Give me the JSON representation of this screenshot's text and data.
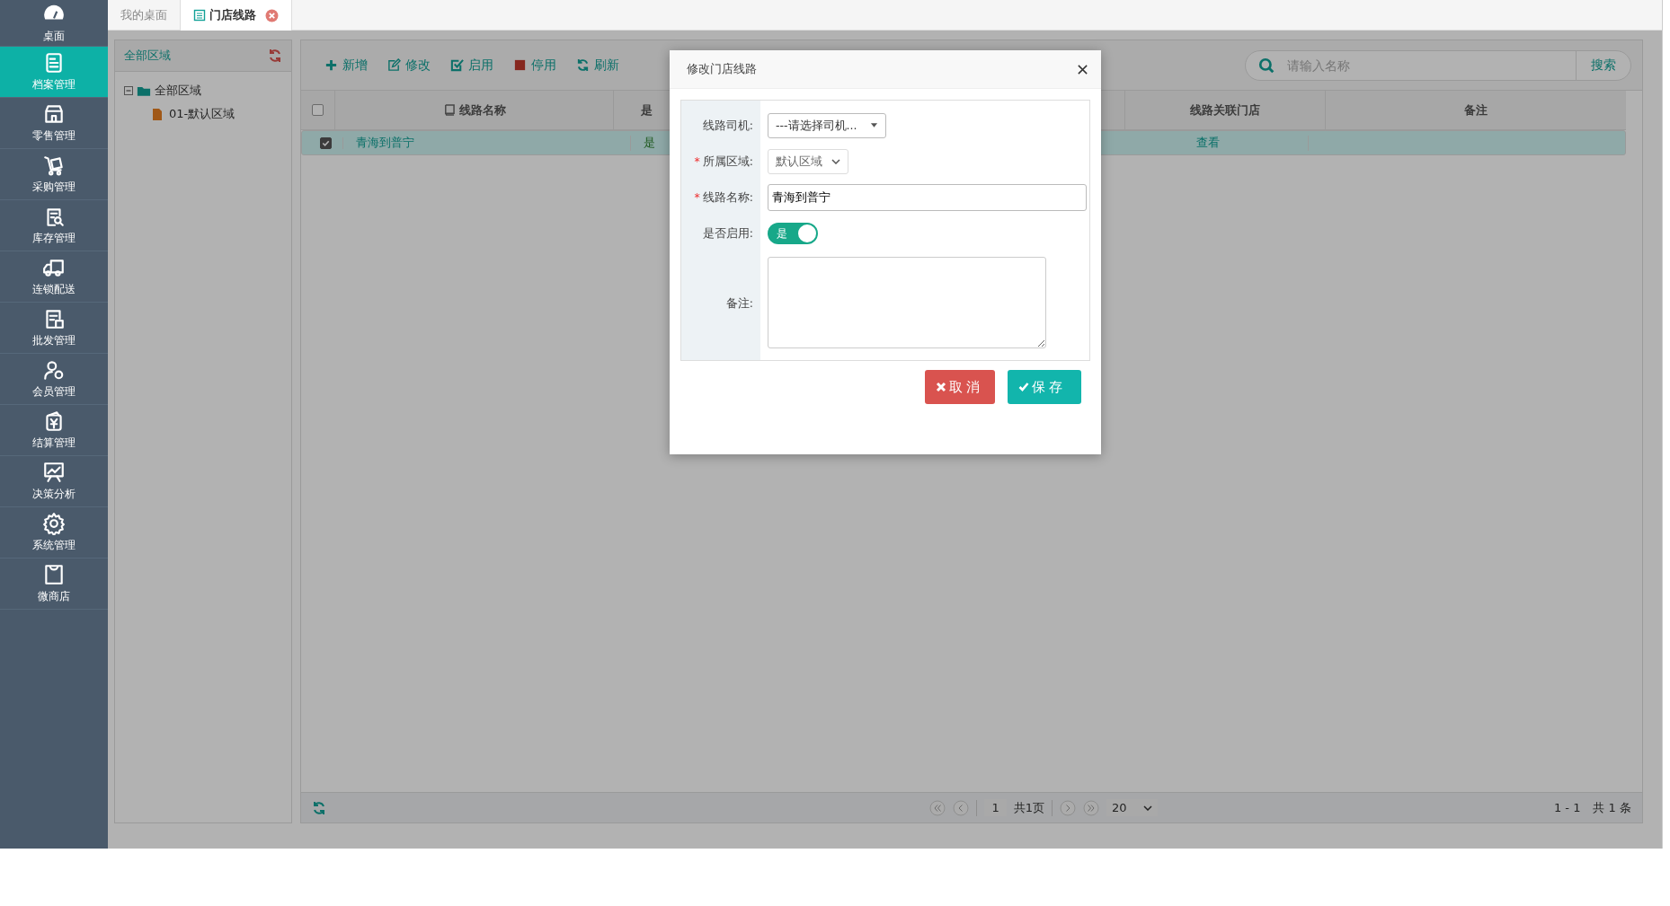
{
  "sidebar": {
    "items": [
      {
        "label": "桌面",
        "selected": false
      },
      {
        "label": "档案管理",
        "selected": true
      },
      {
        "label": "零售管理",
        "selected": false
      },
      {
        "label": "采购管理",
        "selected": false
      },
      {
        "label": "库存管理",
        "selected": false
      },
      {
        "label": "连锁配送",
        "selected": false
      },
      {
        "label": "批发管理",
        "selected": false
      },
      {
        "label": "会员管理",
        "selected": false
      },
      {
        "label": "结算管理",
        "selected": false
      },
      {
        "label": "决策分析",
        "selected": false
      },
      {
        "label": "系统管理",
        "selected": false
      },
      {
        "label": "微商店",
        "selected": false
      }
    ]
  },
  "tabs": [
    {
      "label": "我的桌面",
      "selected": false,
      "closable": false
    },
    {
      "label": "门店线路",
      "selected": true,
      "closable": true
    }
  ],
  "tree_panel": {
    "title": "全部区域",
    "tree": [
      {
        "label": "全部区域",
        "expanded": true,
        "children": [
          {
            "label": "01-默认区域"
          }
        ]
      }
    ]
  },
  "toolbar": {
    "buttons": [
      {
        "kind": "add",
        "label": "新增"
      },
      {
        "kind": "edit",
        "label": "修改"
      },
      {
        "kind": "enable",
        "label": "启用"
      },
      {
        "kind": "disable",
        "label": "停用"
      },
      {
        "kind": "refresh",
        "label": "刷新"
      }
    ],
    "search": {
      "placeholder": "请输入名称",
      "button": "搜索"
    }
  },
  "table": {
    "header_checked": false,
    "columns": [
      {
        "label": "线路名称"
      },
      {
        "label": "是"
      },
      {
        "label": "线路关联门店"
      },
      {
        "label": "备注"
      }
    ],
    "rows": [
      {
        "selected": true,
        "checked": true,
        "name": "青海到普宁",
        "column_2": "是",
        "stores_link": "查看"
      }
    ]
  },
  "pagination": {
    "page": "1",
    "total_pages": "共1页",
    "page_size": "20",
    "range": "1 - 1",
    "total": "共 1 条"
  },
  "dialog": {
    "title": "修改门店线路",
    "fields": [
      {
        "kind": "picker",
        "label": "线路司机:",
        "value": "---请选择司机..."
      },
      {
        "kind": "select",
        "label": "所属区域:",
        "value": "默认区域",
        "marker": "*"
      },
      {
        "kind": "input",
        "label": "线路名称:",
        "value": "青海到普宁",
        "marker": "*"
      },
      {
        "kind": "toggle",
        "label": "是否启用:",
        "on": true,
        "on_text": "是"
      },
      {
        "kind": "textarea",
        "label": "备注:"
      }
    ],
    "buttons": [
      {
        "kind": "cancel",
        "label": "取消"
      },
      {
        "kind": "save",
        "label": "保存"
      }
    ]
  }
}
